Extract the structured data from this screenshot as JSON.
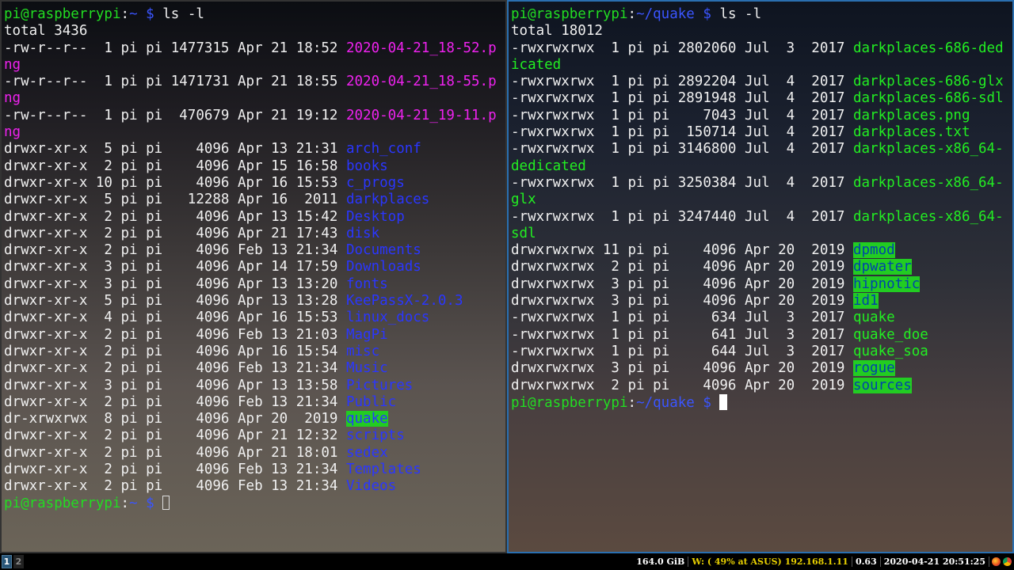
{
  "left_terminal": {
    "prompt_user": "pi@raspberrypi",
    "prompt_sep": ":",
    "prompt_path": "~",
    "prompt_dollar": " $ ",
    "command": "ls -l",
    "total": "total 3436",
    "rows": [
      {
        "meta": "-rw-r--r--  1 pi pi 1477315 Apr 21 18:52 ",
        "name": "2020-04-21_18-52.p",
        "cont": "ng",
        "style": "magenta"
      },
      {
        "meta": "-rw-r--r--  1 pi pi 1471731 Apr 21 18:55 ",
        "name": "2020-04-21_18-55.p",
        "cont": "ng",
        "style": "magenta"
      },
      {
        "meta": "-rw-r--r--  1 pi pi  470679 Apr 21 19:12 ",
        "name": "2020-04-21_19-11.p",
        "cont": "ng",
        "style": "magenta"
      },
      {
        "meta": "drwxr-xr-x  5 pi pi    4096 Apr 13 21:31 ",
        "name": "arch_conf",
        "style": "blue"
      },
      {
        "meta": "drwxr-xr-x  2 pi pi    4096 Apr 15 16:58 ",
        "name": "books",
        "style": "blue"
      },
      {
        "meta": "drwxr-xr-x 10 pi pi    4096 Apr 16 15:53 ",
        "name": "c_progs",
        "style": "blue"
      },
      {
        "meta": "drwxr-xr-x  5 pi pi   12288 Apr 16  2011 ",
        "name": "darkplaces",
        "style": "blue"
      },
      {
        "meta": "drwxr-xr-x  2 pi pi    4096 Apr 13 15:42 ",
        "name": "Desktop",
        "style": "blue"
      },
      {
        "meta": "drwxr-xr-x  2 pi pi    4096 Apr 21 17:43 ",
        "name": "disk",
        "style": "blue"
      },
      {
        "meta": "drwxr-xr-x  2 pi pi    4096 Feb 13 21:34 ",
        "name": "Documents",
        "style": "blue"
      },
      {
        "meta": "drwxr-xr-x  3 pi pi    4096 Apr 14 17:59 ",
        "name": "Downloads",
        "style": "blue"
      },
      {
        "meta": "drwxr-xr-x  3 pi pi    4096 Apr 13 13:20 ",
        "name": "fonts",
        "style": "blue"
      },
      {
        "meta": "drwxr-xr-x  5 pi pi    4096 Apr 13 13:28 ",
        "name": "KeePassX-2.0.3",
        "style": "blue"
      },
      {
        "meta": "drwxr-xr-x  4 pi pi    4096 Apr 16 15:53 ",
        "name": "linux_docs",
        "style": "blue"
      },
      {
        "meta": "drwxr-xr-x  2 pi pi    4096 Feb 13 21:03 ",
        "name": "MagPi",
        "style": "blue"
      },
      {
        "meta": "drwxr-xr-x  2 pi pi    4096 Apr 16 15:54 ",
        "name": "misc",
        "style": "blue"
      },
      {
        "meta": "drwxr-xr-x  2 pi pi    4096 Feb 13 21:34 ",
        "name": "Music",
        "style": "blue"
      },
      {
        "meta": "drwxr-xr-x  3 pi pi    4096 Apr 13 13:58 ",
        "name": "Pictures",
        "style": "blue"
      },
      {
        "meta": "drwxr-xr-x  2 pi pi    4096 Feb 13 21:34 ",
        "name": "Public",
        "style": "blue"
      },
      {
        "meta": "dr-xrwxrwx  8 pi pi    4096 Apr 20  2019 ",
        "name": "quake",
        "style": "hl-blue"
      },
      {
        "meta": "drwxr-xr-x  2 pi pi    4096 Apr 21 12:32 ",
        "name": "scripts",
        "style": "blue"
      },
      {
        "meta": "drwxr-xr-x  2 pi pi    4096 Apr 21 18:01 ",
        "name": "sedex",
        "style": "blue"
      },
      {
        "meta": "drwxr-xr-x  2 pi pi    4096 Feb 13 21:34 ",
        "name": "Templates",
        "style": "blue"
      },
      {
        "meta": "drwxr-xr-x  2 pi pi    4096 Feb 13 21:34 ",
        "name": "Videos",
        "style": "blue"
      }
    ]
  },
  "right_terminal": {
    "prompt_user": "pi@raspberrypi",
    "prompt_sep": ":",
    "prompt_path": "~/quake",
    "prompt_dollar": " $ ",
    "command": "ls -l",
    "total": "total 18012",
    "rows": [
      {
        "meta": "-rwxrwxrwx  1 pi pi 2802060 Jul  3  2017 ",
        "name": "darkplaces-686-ded",
        "cont": "icated",
        "style": "green"
      },
      {
        "meta": "-rwxrwxrwx  1 pi pi 2892204 Jul  4  2017 ",
        "name": "darkplaces-686-glx",
        "style": "green"
      },
      {
        "meta": "-rwxrwxrwx  1 pi pi 2891948 Jul  4  2017 ",
        "name": "darkplaces-686-sdl",
        "style": "green"
      },
      {
        "meta": "-rwxrwxrwx  1 pi pi    7043 Jul  4  2017 ",
        "name": "darkplaces.png",
        "style": "green"
      },
      {
        "meta": "-rwxrwxrwx  1 pi pi  150714 Jul  4  2017 ",
        "name": "darkplaces.txt",
        "style": "green"
      },
      {
        "meta": "-rwxrwxrwx  1 pi pi 3146800 Jul  4  2017 ",
        "name": "darkplaces-x86_64-",
        "cont": "dedicated",
        "style": "green"
      },
      {
        "meta": "-rwxrwxrwx  1 pi pi 3250384 Jul  4  2017 ",
        "name": "darkplaces-x86_64-",
        "cont": "glx",
        "style": "green"
      },
      {
        "meta": "-rwxrwxrwx  1 pi pi 3247440 Jul  4  2017 ",
        "name": "darkplaces-x86_64-",
        "cont": "sdl",
        "style": "green"
      },
      {
        "meta": "drwxrwxrwx 11 pi pi    4096 Apr 20  2019 ",
        "name": "dpmod",
        "style": "hl-green"
      },
      {
        "meta": "drwxrwxrwx  2 pi pi    4096 Apr 20  2019 ",
        "name": "dpwater",
        "style": "hl-green"
      },
      {
        "meta": "drwxrwxrwx  3 pi pi    4096 Apr 20  2019 ",
        "name": "hipnotic",
        "style": "hl-green"
      },
      {
        "meta": "drwxrwxrwx  3 pi pi    4096 Apr 20  2019 ",
        "name": "id1",
        "style": "hl-green"
      },
      {
        "meta": "-rwxrwxrwx  1 pi pi     634 Jul  3  2017 ",
        "name": "quake",
        "style": "green"
      },
      {
        "meta": "-rwxrwxrwx  1 pi pi     641 Jul  3  2017 ",
        "name": "quake_doe",
        "style": "green"
      },
      {
        "meta": "-rwxrwxrwx  1 pi pi     644 Jul  3  2017 ",
        "name": "quake_soa",
        "style": "green"
      },
      {
        "meta": "drwxrwxrwx  3 pi pi    4096 Apr 20  2019 ",
        "name": "rogue",
        "style": "hl-green"
      },
      {
        "meta": "drwxrwxrwx  2 pi pi    4096 Apr 20  2019 ",
        "name": "sources",
        "style": "hl-green"
      }
    ]
  },
  "statusbar": {
    "workspaces": [
      {
        "label": "1",
        "active": true
      },
      {
        "label": "2",
        "active": false
      }
    ],
    "disk": "164.0 GiB",
    "wifi": "W: ( 49% at ASUS) 192.168.1.11",
    "load": "0.63",
    "datetime": "2020-04-21 20:51:25",
    "tray_icons": [
      "firefox-icon",
      "chromium-icon"
    ]
  },
  "colors": {
    "user": "#22dd22",
    "path": "#3a55ff",
    "magenta": "#ee22ee",
    "blue": "#2a36ff",
    "green": "#22ee22",
    "highlight_bg": "#22cc22",
    "focus_border": "#2a6fb0"
  }
}
